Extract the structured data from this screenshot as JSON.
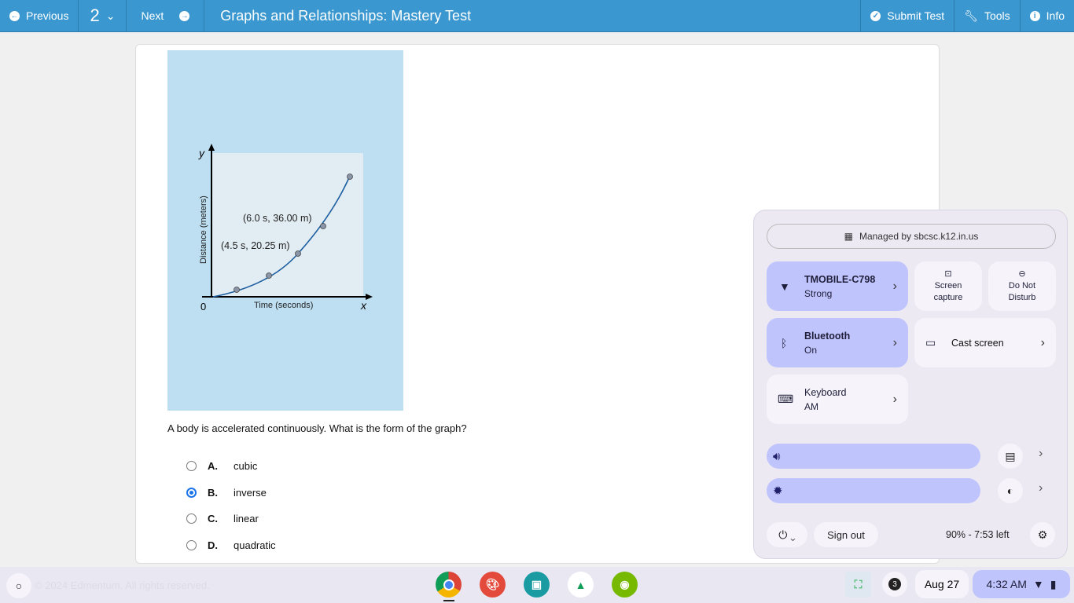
{
  "toolbar": {
    "previous": "Previous",
    "question_number": "2",
    "next": "Next",
    "title": "Graphs and Relationships: Mastery Test",
    "submit": "Submit Test",
    "tools": "Tools",
    "info": "Info"
  },
  "figure": {
    "y_axis": "y",
    "x_axis": "x",
    "origin": "0",
    "ylabel": "Distance (meters)",
    "xlabel": "Time (seconds)",
    "label1": "(6.0 s, 36.00 m)",
    "label2": "(4.5 s, 20.25 m)"
  },
  "question": "A body is accelerated continuously. What is the form of the graph?",
  "options": [
    {
      "letter": "A.",
      "text": "cubic",
      "selected": false
    },
    {
      "letter": "B.",
      "text": "inverse",
      "selected": true
    },
    {
      "letter": "C.",
      "text": "linear",
      "selected": false
    },
    {
      "letter": "D.",
      "text": "quadratic",
      "selected": false
    }
  ],
  "footer": "© 2024 Edmentum. All rights reserved.",
  "quick_settings": {
    "managed": "Managed by sbcsc.k12.in.us",
    "wifi": {
      "name": "TMOBILE-C798",
      "status": "Strong"
    },
    "screen_capture": "Screen capture",
    "dnd": "Do Not Disturb",
    "bluetooth": {
      "name": "Bluetooth",
      "status": "On"
    },
    "cast": "Cast screen",
    "keyboard": {
      "name": "Keyboard",
      "status": "AM"
    },
    "volume_level": 1.0,
    "brightness_level": 1.0,
    "sign_out": "Sign out",
    "battery": "90% - 7:53 left"
  },
  "shelf": {
    "notifications": "3",
    "date": "Aug 27",
    "time": "4:32 AM"
  },
  "colors": {
    "toolbar": "#3a97cf",
    "accent": "#c0c4fc"
  }
}
